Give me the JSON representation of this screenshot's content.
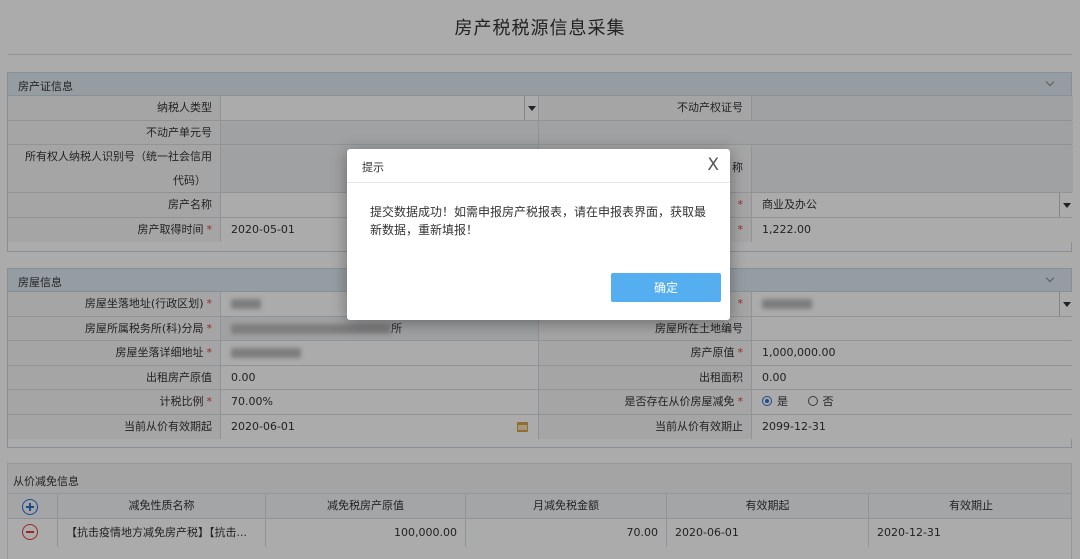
{
  "page": {
    "title": "房产税税源信息采集"
  },
  "cert_section": {
    "title": "房产证信息",
    "taxpayer_type_label": "纳税人类型",
    "taxpayer_type_value": "",
    "property_cert_label": "不动产权证号",
    "property_cert_value": "",
    "unit_no_label": "不动产单元号",
    "unit_no_value": "",
    "owner_id_label_1": "所有权人纳税人识别号（统一社会信用",
    "owner_id_label_2": "代码）",
    "owner_name_label_fragment": "称",
    "property_name_label": "房产名称",
    "property_name_value": "",
    "usage_value": "商业及办公",
    "acquire_date_label": "房产取得时间",
    "acquire_date_value": "2020-05-01",
    "area_value": "1,222.00"
  },
  "house_section": {
    "title": "房屋信息",
    "address_region_label": "房屋坐落地址(行政区划)",
    "tax_office_label": "房屋所属税务所(科)分局",
    "tax_office_value_suffix": "所",
    "land_no_label": "房屋所在土地编号",
    "land_no_value": "",
    "detail_address_label": "房屋坐落详细地址",
    "original_value_label": "房产原值",
    "original_value": "1,000,000.00",
    "rent_original_label": "出租房产原值",
    "rent_original_value": "0.00",
    "rent_area_label": "出租面积",
    "rent_area_value": "0.00",
    "tax_ratio_label": "计税比例",
    "tax_ratio_value": "70.00%",
    "exemption_label": "是否存在从价房屋减免",
    "exemption_yes": "是",
    "exemption_no": "否",
    "start_label": "当前从价有效期起",
    "start_value": "2020-06-01",
    "end_label": "当前从价有效期止",
    "end_value": "2099-12-31"
  },
  "relief_section": {
    "title": "从价减免信息",
    "headers": [
      "减免性质名称",
      "减免税房产原值",
      "月减免税金额",
      "有效期起",
      "有效期止"
    ],
    "rows": [
      {
        "name": "【抗击疫情地方减免房产税】【抗击...",
        "original": "100,000.00",
        "monthly": "70.00",
        "start": "2020-06-01",
        "end": "2020-12-31"
      }
    ]
  },
  "dialog": {
    "title": "提示",
    "close": "X",
    "message": "提交数据成功！如需申报房产税报表，请在申报表界面，获取最新数据，重新填报！",
    "ok_label": "确定"
  },
  "colors": {
    "accent": "#55aef0",
    "required": "#e03c3c",
    "section_header": "#dfeaf4"
  }
}
